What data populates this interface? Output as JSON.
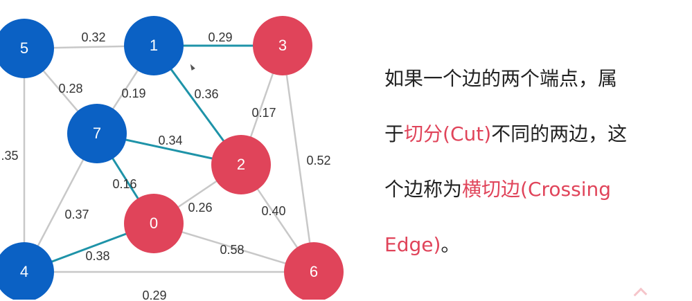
{
  "colors": {
    "blue": "#0b61c4",
    "red": "#e0445a",
    "edge_gray": "#c8c8c8",
    "edge_teal": "#1e93a8",
    "highlight": "#e0445a"
  },
  "nodes": [
    {
      "id": "5",
      "label": "5",
      "side": "blue"
    },
    {
      "id": "1",
      "label": "1",
      "side": "blue"
    },
    {
      "id": "3",
      "label": "3",
      "side": "red"
    },
    {
      "id": "7",
      "label": "7",
      "side": "blue"
    },
    {
      "id": "2",
      "label": "2",
      "side": "red"
    },
    {
      "id": "0",
      "label": "0",
      "side": "red"
    },
    {
      "id": "4",
      "label": "4",
      "side": "blue"
    },
    {
      "id": "6",
      "label": "6",
      "side": "red"
    }
  ],
  "edges": [
    {
      "from": "5",
      "to": "1",
      "weight": "0.32",
      "crossing": false
    },
    {
      "from": "1",
      "to": "3",
      "weight": "0.29",
      "crossing": true
    },
    {
      "from": "5",
      "to": "7",
      "weight": "0.28",
      "crossing": false
    },
    {
      "from": "1",
      "to": "7",
      "weight": "0.19",
      "crossing": false
    },
    {
      "from": "1",
      "to": "2",
      "weight": "0.36",
      "crossing": true
    },
    {
      "from": "3",
      "to": "2",
      "weight": "0.17",
      "crossing": false
    },
    {
      "from": "3",
      "to": "6",
      "weight": "0.52",
      "crossing": false
    },
    {
      "from": "7",
      "to": "2",
      "weight": "0.34",
      "crossing": true
    },
    {
      "from": "5",
      "to": "4",
      "weight": ".35",
      "crossing": false
    },
    {
      "from": "7",
      "to": "0",
      "weight": "0.16",
      "crossing": true
    },
    {
      "from": "7",
      "to": "4",
      "weight": "0.37",
      "crossing": false
    },
    {
      "from": "0",
      "to": "2",
      "weight": "0.26",
      "crossing": false
    },
    {
      "from": "2",
      "to": "6",
      "weight": "0.40",
      "crossing": false
    },
    {
      "from": "4",
      "to": "0",
      "weight": "0.38",
      "crossing": true
    },
    {
      "from": "0",
      "to": "6",
      "weight": "0.58",
      "crossing": false
    },
    {
      "from": "4",
      "to": "6",
      "weight": "0.29",
      "crossing": false
    }
  ],
  "text": {
    "line1": "如果一个边的两个端点，属",
    "line2_a": "于",
    "line2_b": "切分(Cut)",
    "line2_c": "不同的两边，这",
    "line3_a": "个边称为",
    "line3_b": "横切边(Crossing",
    "line4_a": "Edge)",
    "line4_b": "。"
  }
}
